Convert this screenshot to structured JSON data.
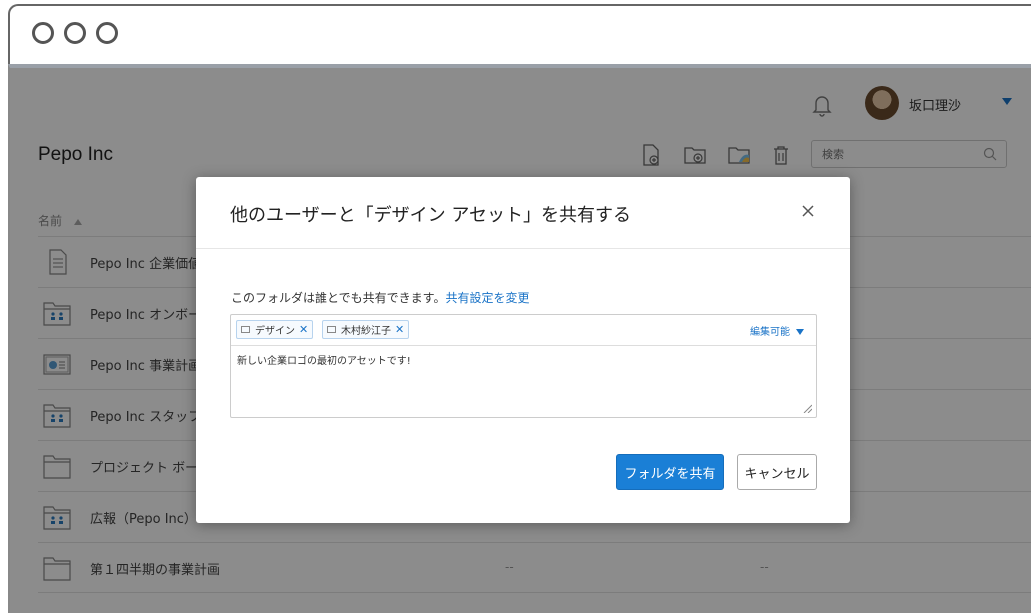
{
  "header": {
    "username": "坂口理沙",
    "page_title": "Pepo Inc",
    "search_placeholder": "検索"
  },
  "file_list": {
    "column_name": "名前",
    "rows": [
      {
        "name": "Pepo Inc 企業価値",
        "icon": "document-icon",
        "col1": "",
        "col2": ""
      },
      {
        "name": "Pepo Inc オンボーディ",
        "icon": "shared-folder-icon",
        "col1": "",
        "col2": ""
      },
      {
        "name": "Pepo Inc 事業計画書",
        "icon": "presentation-icon",
        "col1": "",
        "col2": ""
      },
      {
        "name": "Pepo Inc スタッフ",
        "icon": "shared-folder-icon",
        "col1": "",
        "col2": ""
      },
      {
        "name": "プロジェクト ボード",
        "icon": "folder-icon",
        "col1": "",
        "col2": ""
      },
      {
        "name": "広報（Pepo Inc）",
        "icon": "shared-folder-icon",
        "col1": "",
        "col2": ""
      },
      {
        "name": "第１四半期の事業計画",
        "icon": "folder-icon",
        "col1": "--",
        "col2": "--"
      }
    ]
  },
  "modal": {
    "title": "他のユーザーと「デザイン アセット」を共有する",
    "description": "このフォルダは誰とでも共有できます。",
    "change_settings_link": "共有設定を変更",
    "tags": [
      {
        "label": "デザイン"
      },
      {
        "label": "木村紗江子"
      }
    ],
    "permission": "編集可能",
    "message": "新しい企業ロゴの最初のアセットです!",
    "share_button": "フォルダを共有",
    "cancel_button": "キャンセル"
  },
  "colors": {
    "accent": "#1a7fd6",
    "link": "#1a73c7",
    "overlay": "rgba(0,0,0,0.45)"
  }
}
